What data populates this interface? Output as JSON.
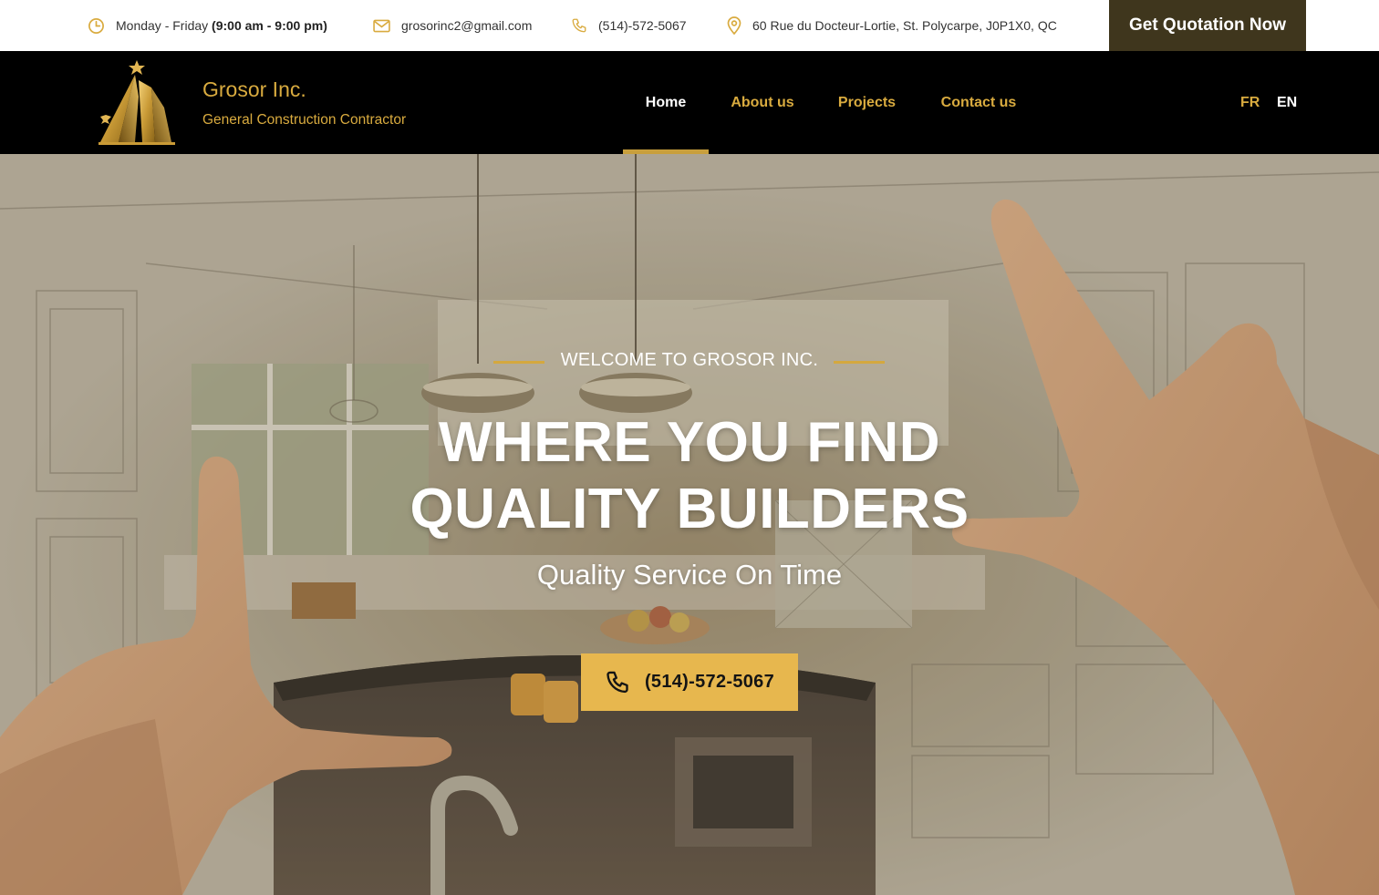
{
  "colors": {
    "accent": "#d9ab3f",
    "button_gold": "#e7b74e",
    "quote_bg": "#3f361d",
    "nav_bg": "#000000"
  },
  "topbar": {
    "hours_prefix": "Monday - Friday",
    "hours_time": "(9:00 am - 9:00 pm)",
    "email": "grosorinc2@gmail.com",
    "phone": "(514)-572-5067",
    "address": "60 Rue du Docteur-Lortie, St. Polycarpe, J0P1X0, QC",
    "quote_button": "Get Quotation Now",
    "icons": [
      "clock-icon",
      "mail-icon",
      "phone-icon",
      "location-pin-icon"
    ]
  },
  "header": {
    "brand_name": "Grosor Inc.",
    "brand_tagline": "General Construction Contractor",
    "nav": [
      {
        "label": "Home",
        "active": true
      },
      {
        "label": "About us",
        "active": false
      },
      {
        "label": "Projects",
        "active": false
      },
      {
        "label": "Contact us",
        "active": false
      }
    ],
    "languages": [
      {
        "label": "FR",
        "active": false
      },
      {
        "label": "EN",
        "active": true
      }
    ]
  },
  "hero": {
    "kicker": "WELCOME TO GROSOR INC.",
    "title_line1": "WHERE YOU FIND",
    "title_line2": "QUALITY BUILDERS",
    "subtitle": "Quality Service On Time",
    "call_button": "(514)-572-5067"
  }
}
